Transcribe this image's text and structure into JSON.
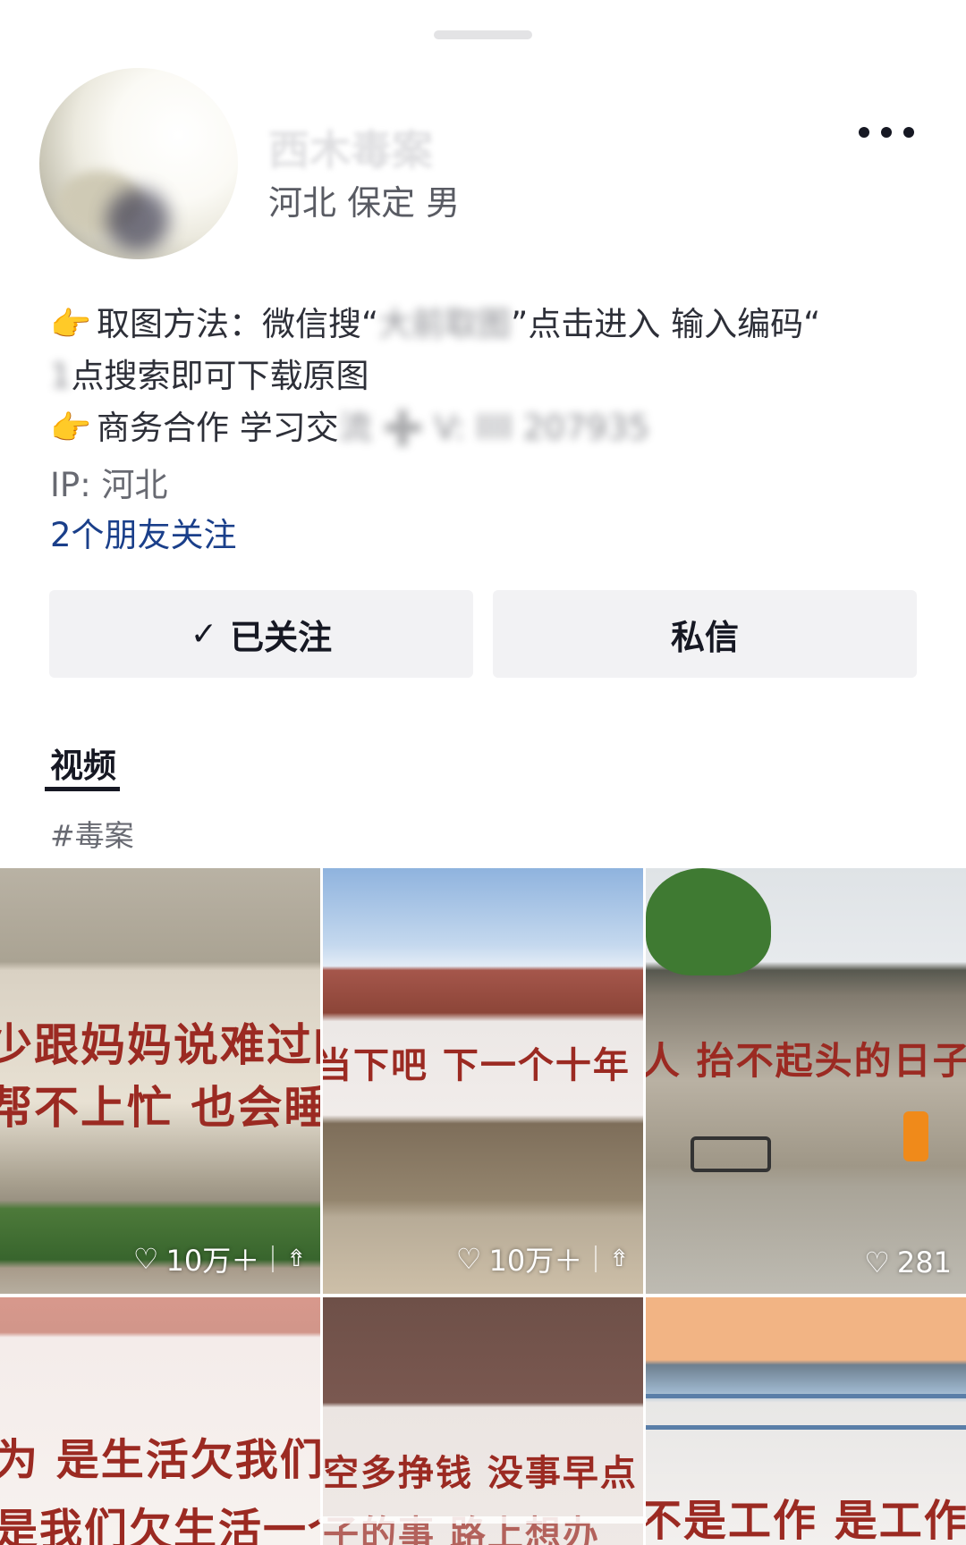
{
  "profile": {
    "name": "西木毒案",
    "location": "河北 保定 男",
    "bio_lines": [
      {
        "emoji": "👉",
        "text": "取图方法：微信搜“",
        "blurred": "大前取图",
        "tail": "”点击进入 输入编码“"
      },
      {
        "emoji": "",
        "text": "",
        "blurred": "1",
        "tail": "点搜索即可下载原图"
      },
      {
        "emoji": "👉",
        "text": "商务合作 学习交",
        "blurred": "流 ➕ V: llll 207935",
        "tail": ""
      }
    ],
    "ip": "IP: 河北",
    "friends_following": "2个朋友关注"
  },
  "actions": {
    "follow_check": "✓",
    "follow_label": "已关注",
    "message_label": "私信"
  },
  "tabs": [
    {
      "label": "视频",
      "active": true
    }
  ],
  "hashtag": "#毒案",
  "videos": [
    {
      "text_line1": "少跟妈妈说难过的事",
      "text_line2": "帮不上忙 也会睡不着",
      "likes": "10万＋",
      "pinned": true
    },
    {
      "text_line1": "当下吧 下一个十年 就不再是贫",
      "text_line2": "",
      "likes": "10万＋",
      "pinned": true
    },
    {
      "text_line1": "人 抬不起头的日子我比谁",
      "text_line2": "",
      "likes": "281",
      "pinned": false
    },
    {
      "text_line1": "为 是生活欠我们一个",
      "text_line2": "是我们欠生活一个“努",
      "likes": "",
      "pinned": false
    },
    {
      "text_line1": "空多挣钱 没事早点",
      "text_line2": "子的事 路上想办",
      "likes": "",
      "pinned": false
    },
    {
      "text_line1": "不是工作 是工作中遇",
      "text_line2": "",
      "likes": "",
      "pinned": false
    }
  ]
}
